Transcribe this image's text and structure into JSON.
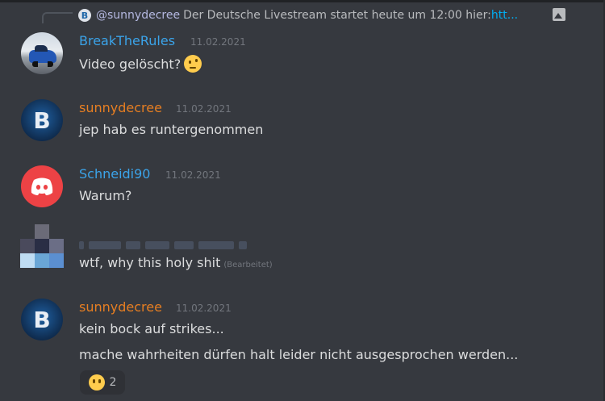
{
  "reply": {
    "author": "@sunnydecree",
    "text": "Der Deutsche Livestream startet heute um 12:00 hier: ",
    "link": "htt...",
    "avatar_letter": "B"
  },
  "messages": [
    {
      "author": "BreakTheRules",
      "author_color": "#3ba4ea",
      "timestamp": "11.02.2021",
      "lines": [
        "Video gelöscht?"
      ],
      "emoji": "thinking-face"
    },
    {
      "author": "sunnydecree",
      "author_color": "#e67e22",
      "timestamp": "11.02.2021",
      "lines": [
        "jep hab es runtergenommen"
      ]
    },
    {
      "author": "Schneidi90",
      "author_color": "#3ba4ea",
      "timestamp": "11.02.2021",
      "lines": [
        "Warum?"
      ]
    },
    {
      "author": "",
      "lines": [
        "wtf, why this holy shit"
      ],
      "edited": "(Bearbeitet)"
    },
    {
      "author": "sunnydecree",
      "author_color": "#e67e22",
      "timestamp": "11.02.2021",
      "lines": [
        "kein bock auf strikes...",
        "mache wahrheiten dürfen halt leider nicht ausgesprochen werden..."
      ],
      "reaction": {
        "emoji": "face-without-mouth",
        "count": "2"
      }
    }
  ],
  "avatars": {
    "btc_letter": "B",
    "pixel_colors": [
      "#36393f",
      "#6b6b78",
      "#36393f",
      "#4a4a5c",
      "#2a2e45",
      "#6b6e86",
      "#bfdcf3",
      "#6aa6d6",
      "#5b8fd1"
    ]
  }
}
